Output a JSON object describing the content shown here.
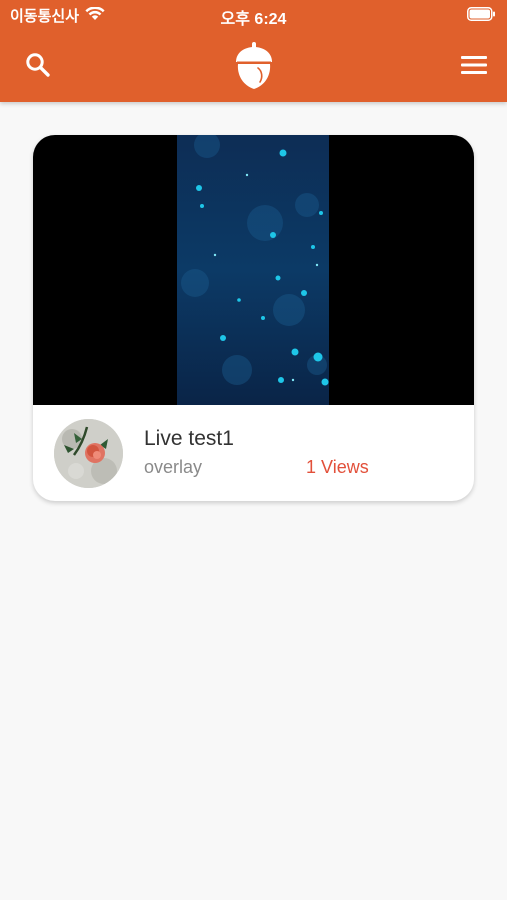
{
  "status_bar": {
    "carrier": "이동통신사",
    "time": "오후 6:24"
  },
  "header": {
    "search_icon": "search-icon",
    "logo_icon": "acorn-logo-icon",
    "menu_icon": "hamburger-menu-icon",
    "background_color": "#e0602c"
  },
  "stream_card": {
    "title": "Live test1",
    "subtitle": "overlay",
    "views": "1 Views",
    "views_color": "#e2503a"
  }
}
